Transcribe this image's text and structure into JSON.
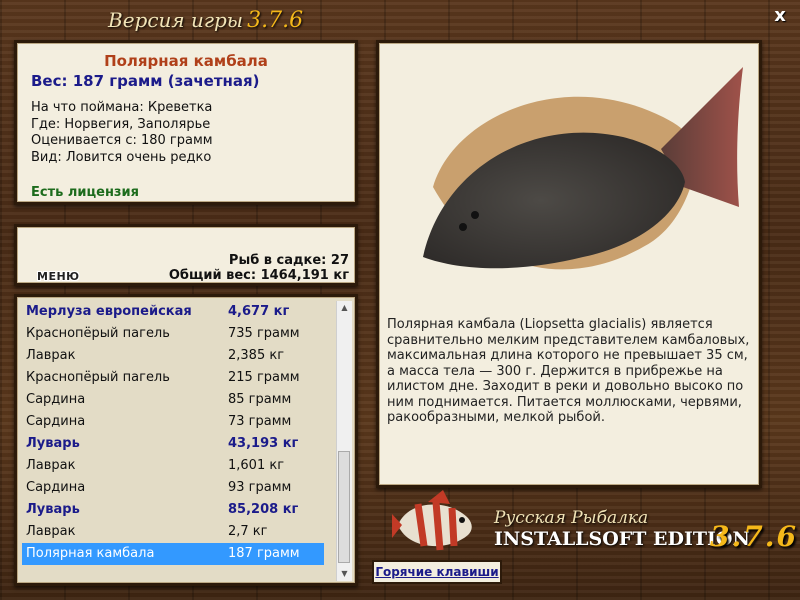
{
  "header": {
    "title": "Версия игры",
    "version": "3.7.6",
    "close_label": "x"
  },
  "info": {
    "name": "Полярная камбала",
    "weight": "Вес: 187 грамм (зачетная)",
    "lines": [
      "На что поймана: Креветка",
      "Где: Норвегия, Заполярье",
      "Оценивается с: 180 грамм",
      "Вид: Ловится очень редко"
    ],
    "license": "Есть лицензия"
  },
  "stats": {
    "menu_label": "МЕНЮ",
    "fish_count": "Рыб в садке: 27",
    "total_weight": "Общий вес: 1464,191 кг"
  },
  "catch_list": [
    {
      "name": "Мерлуза европейская",
      "weight": "4,677 кг"
    },
    {
      "name": "Краснопёрый пагель",
      "weight": "735 грамм"
    },
    {
      "name": "Лаврак",
      "weight": "2,385 кг"
    },
    {
      "name": "Краснопёрый пагель",
      "weight": "215 грамм"
    },
    {
      "name": "Сардина",
      "weight": "85 грамм"
    },
    {
      "name": "Сардина",
      "weight": "73 грамм"
    },
    {
      "name": "Луварь",
      "weight": "43,193 кг"
    },
    {
      "name": "Лаврак",
      "weight": "1,601 кг"
    },
    {
      "name": "Сардина",
      "weight": "93 грамм"
    },
    {
      "name": "Луварь",
      "weight": "85,208 кг"
    },
    {
      "name": "Лаврак",
      "weight": "2,7 кг"
    },
    {
      "name": "Полярная камбала",
      "weight": "187 грамм"
    }
  ],
  "description": "Полярная камбала (Liopsetta glacialis) является сравнительно мелким представителем камбаловых, максимальная длина которого не превышает 35 см, а масса тела — 300 г. Держится в прибрежье на илистом дне. Заходит в реки и довольно высоко по ним поднимается. Питается моллюсками, червями, ракообразными, мелкой рыбой.",
  "hotkeys_label": "Горячие клавиши",
  "logo": {
    "line1": "Русская Рыбалка",
    "line2": "INSTALLSOFT EDITION",
    "version": "3.7.6"
  },
  "colors": {
    "highlight_row": "#3399ff",
    "bold_row": "#1b1b8a",
    "fish_name": "#b0401a",
    "license": "#1c6b1c"
  }
}
